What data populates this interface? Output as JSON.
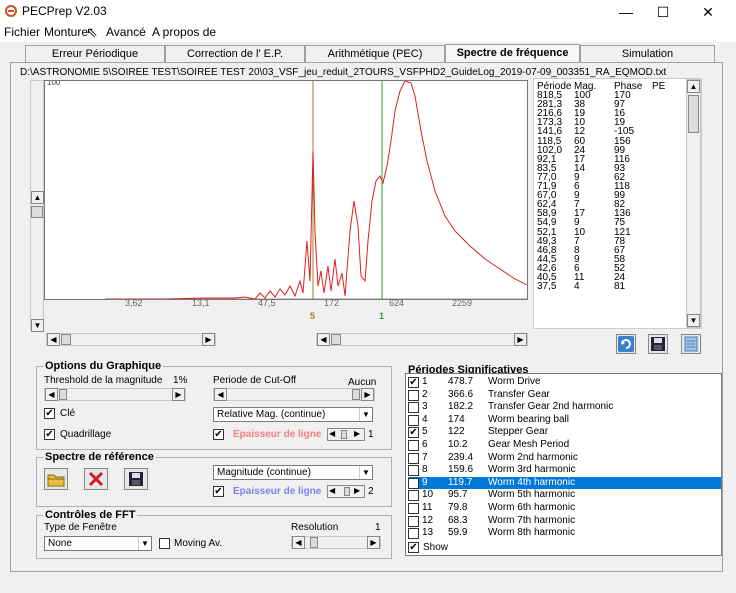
{
  "window": {
    "title": "PECPrep V2.03",
    "minimize": "—",
    "maximize": "☐",
    "close": "✕"
  },
  "menu": [
    "Fichier",
    "Monture",
    "Avancé",
    "A propos de"
  ],
  "tabs": [
    "Erreur Périodique",
    "Correction de l' E.P.",
    "Arithmétique (PEC)",
    "Spectre de fréquence",
    "Simulation"
  ],
  "active_tab": "Spectre de fréquence",
  "filepath": "D:\\ASTRONOMIE 5\\SOIREE TEST\\SOIREE TEST 20\\03_VSF_jeu_reduit_2TOURS_VSFPHD2_GuideLog_2019-07-09_003351_RA_EQMOD.txt",
  "graph": {
    "top_label": "100",
    "x_tick_labels": [
      "3,62",
      "13,1",
      "47,5",
      "172",
      "624",
      "2259"
    ],
    "markers": [
      {
        "label": "5",
        "color": "#a08020"
      },
      {
        "label": "1",
        "color": "#2ea02e"
      }
    ],
    "line_color": "#e02020"
  },
  "table": {
    "headers": [
      "Période",
      "Mag.",
      "Phase",
      "PE"
    ],
    "rows": [
      [
        "818,5",
        "100",
        "170"
      ],
      [
        "281,3",
        "38",
        "97"
      ],
      [
        "216,6",
        "19",
        "16"
      ],
      [
        "173,3",
        "10",
        "19"
      ],
      [
        "141,6",
        "12",
        "-105"
      ],
      [
        "118,5",
        "60",
        "156"
      ],
      [
        "102,0",
        "24",
        "99"
      ],
      [
        "92,1",
        "17",
        "116"
      ],
      [
        "83,5",
        "14",
        "93"
      ],
      [
        "77,0",
        "9",
        "62"
      ],
      [
        "71,9",
        "6",
        "118"
      ],
      [
        "67,0",
        "9",
        "99"
      ],
      [
        "62,4",
        "7",
        "82"
      ],
      [
        "58,9",
        "17",
        "136"
      ],
      [
        "54,9",
        "9",
        "75"
      ],
      [
        "52,1",
        "10",
        "121"
      ],
      [
        "49,3",
        "7",
        "78"
      ],
      [
        "46,8",
        "8",
        "67"
      ],
      [
        "44,5",
        "9",
        "58"
      ],
      [
        "42,6",
        "6",
        "52"
      ],
      [
        "40,5",
        "11",
        "24"
      ],
      [
        "37,5",
        "4",
        "81"
      ]
    ]
  },
  "options": {
    "title": "Options du Graphique",
    "threshold_label": "Threshold de la magnitude",
    "threshold_value": "1%",
    "cutoff_label": "Periode de Cut-Off",
    "cutoff_value": "Aucun",
    "cle_label": "Clé",
    "quadrillage_label": "Quadrillage",
    "mag_select": "Relative Mag. (continue)",
    "epaisseur_label": "Epaisseur de ligne",
    "epaisseur_value": "1",
    "epaisseur_color": "#f08080"
  },
  "spectre": {
    "title": "Spectre de référence",
    "mag_select": "Magnitude (continue)",
    "epaisseur_label": "Epaisseur de ligne",
    "epaisseur_value": "2",
    "epaisseur_color": "#8080f0"
  },
  "fft": {
    "title": "Contrôles de FFT",
    "window_label": "Type de Fenêtre",
    "window_value": "None",
    "moving_label": "Moving Av.",
    "resolution_label": "Resolution",
    "resolution_value": "1"
  },
  "periods": {
    "title": "Périodes Significatives",
    "show_label": "Show",
    "rows": [
      {
        "n": "1",
        "p": "478.7",
        "name": "Worm Drive",
        "checked": true
      },
      {
        "n": "2",
        "p": "366.6",
        "name": "Transfer Gear",
        "checked": false
      },
      {
        "n": "3",
        "p": "182.2",
        "name": "Transfer Gear 2nd harmonic",
        "checked": false
      },
      {
        "n": "4",
        "p": "174",
        "name": "Worm bearing ball",
        "checked": false
      },
      {
        "n": "5",
        "p": "122",
        "name": "Stepper Gear",
        "checked": true
      },
      {
        "n": "6",
        "p": "10.2",
        "name": "Gear Mesh Period",
        "checked": false
      },
      {
        "n": "7",
        "p": "239.4",
        "name": "Worm 2nd harmonic",
        "checked": false
      },
      {
        "n": "8",
        "p": "159.6",
        "name": "Worm 3rd harmonic",
        "checked": false
      },
      {
        "n": "9",
        "p": "119.7",
        "name": "Worm 4th harmonic",
        "checked": false,
        "selected": true
      },
      {
        "n": "10",
        "p": "95.7",
        "name": "Worm 5th harmonic",
        "checked": false
      },
      {
        "n": "11",
        "p": "79.8",
        "name": "Worm 6th harmonic",
        "checked": false
      },
      {
        "n": "12",
        "p": "68.3",
        "name": "Worm 7th harmonic",
        "checked": false
      },
      {
        "n": "13",
        "p": "59.9",
        "name": "Worm 8th harmonic",
        "checked": false
      }
    ]
  }
}
